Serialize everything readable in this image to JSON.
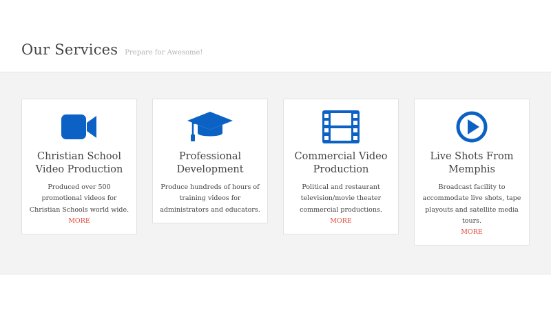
{
  "header": {
    "title": "Our Services",
    "subtitle": "Prepare for Awesome!"
  },
  "colors": {
    "icon": "#0b62c4",
    "link": "#e2473b",
    "band": "#f3f3f3"
  },
  "services": [
    {
      "icon": "video-camera-icon",
      "title": "Christian School Video Production",
      "description": "Produced over 500 promotional videos for Christian Schools world wide.",
      "more_label": "MORE"
    },
    {
      "icon": "graduation-cap-icon",
      "title": "Professional Development",
      "description": "Produce hundreds of hours of training videos for administrators and educators."
    },
    {
      "icon": "film-strip-icon",
      "title": "Commercial Video Production",
      "description": "Political and restaurant television/movie theater commercial productions.",
      "more_label": "MORE"
    },
    {
      "icon": "play-circle-icon",
      "title": "Live Shots From Memphis",
      "description": "Broadcast facility to accommodate live shots, tape playouts and satellite media tours.",
      "more_label": "MORE"
    }
  ]
}
